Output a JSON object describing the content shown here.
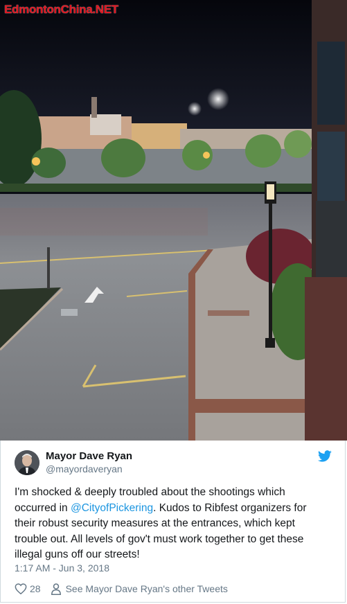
{
  "photo": {
    "watermark": "EdmontonChina.NET"
  },
  "tweet": {
    "author_name": "Mayor Dave Ryan",
    "author_handle": "@mayordaveryan",
    "text_before": "I'm shocked & deeply troubled about the shootings which occurred in ",
    "mention": "@CityofPickering",
    "text_after": ". Kudos to Ribfest organizers for their robust security measures at the entrances, which kept trouble out. All levels of gov't must work together to get these illegal guns off our streets!",
    "timestamp": "1:17 AM - Jun 3, 2018",
    "like_count": "28",
    "other_tweets_label": "See Mayor Dave Ryan's other Tweets"
  },
  "icons": {
    "brand": "twitter-bird-icon",
    "like": "heart-icon",
    "profile": "person-icon"
  },
  "colors": {
    "watermark": "#e0141e",
    "link": "#1b95e0",
    "secondary_text": "#657786",
    "twitter_blue": "#1da1f2"
  }
}
